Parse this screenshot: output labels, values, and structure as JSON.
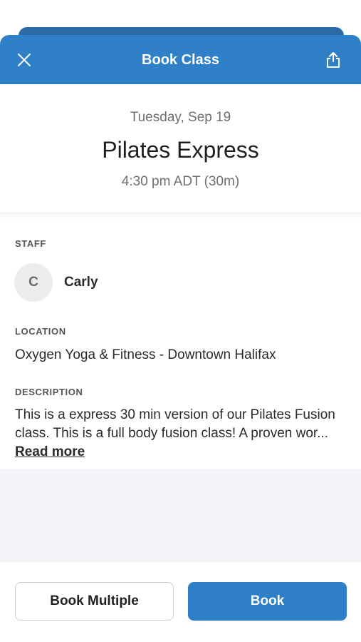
{
  "header": {
    "title": "Book Class",
    "close_icon": "close-icon",
    "share_icon": "share-icon",
    "accent_color": "#2f80c8"
  },
  "class_info": {
    "date": "Tuesday, Sep 19",
    "name": "Pilates Express",
    "time": "4:30 pm ADT (30m)"
  },
  "staff": {
    "label": "STAFF",
    "avatar_initial": "C",
    "name": "Carly"
  },
  "location": {
    "label": "LOCATION",
    "value": "Oxygen Yoga & Fitness - Downtown Halifax"
  },
  "description": {
    "label": "DESCRIPTION",
    "line1": "This is a express 30 min version of our Pilates Fusion",
    "line2": "class. This is a full body fusion class! A proven wor...",
    "read_more": "Read more"
  },
  "footer": {
    "book_multiple_label": "Book Multiple",
    "book_label": "Book"
  }
}
